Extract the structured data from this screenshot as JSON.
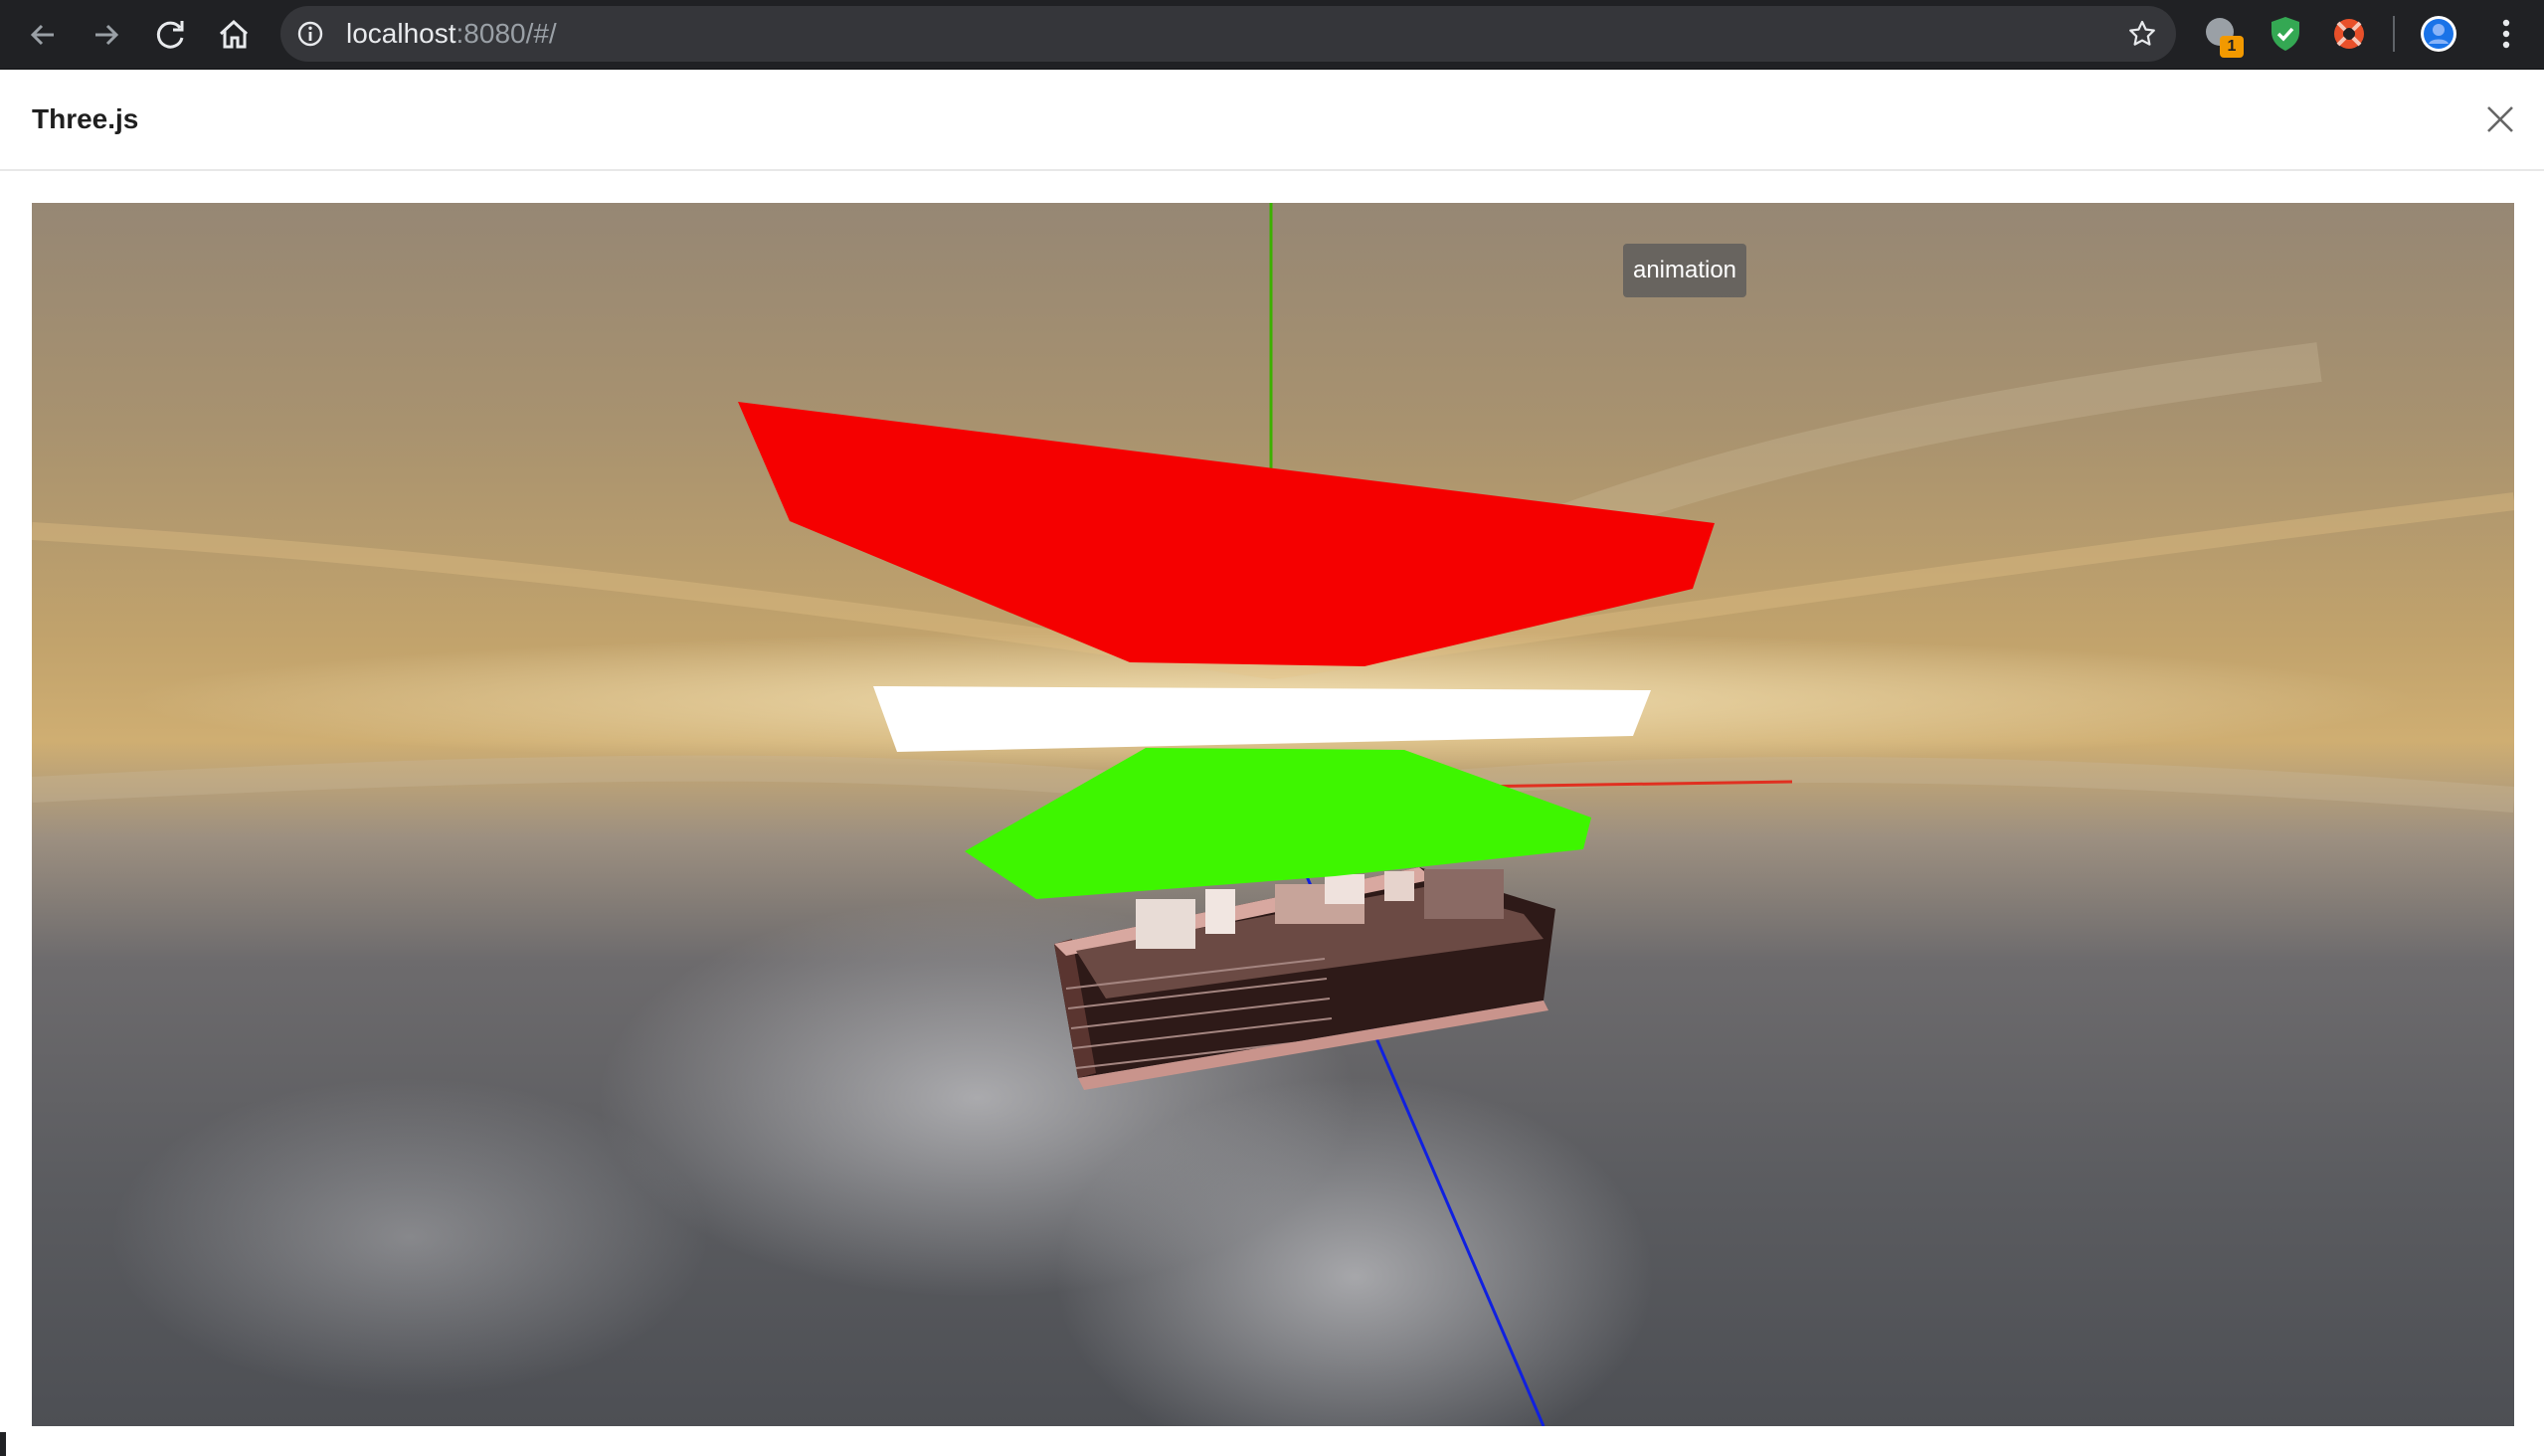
{
  "browser": {
    "url_host": "localhost",
    "url_path": ":8080/#/",
    "extension_badge": "1"
  },
  "modal": {
    "title": "Three.js"
  },
  "scene": {
    "animation_button_label": "animation",
    "colors": {
      "top_plane": "#f50000",
      "middle_plane": "#ffffff",
      "bottom_plane": "#3ef600",
      "axis_y": "#3cb000",
      "axis_x": "#e03020",
      "axis_z": "#1020e0",
      "room": "#3a1f1c"
    }
  }
}
